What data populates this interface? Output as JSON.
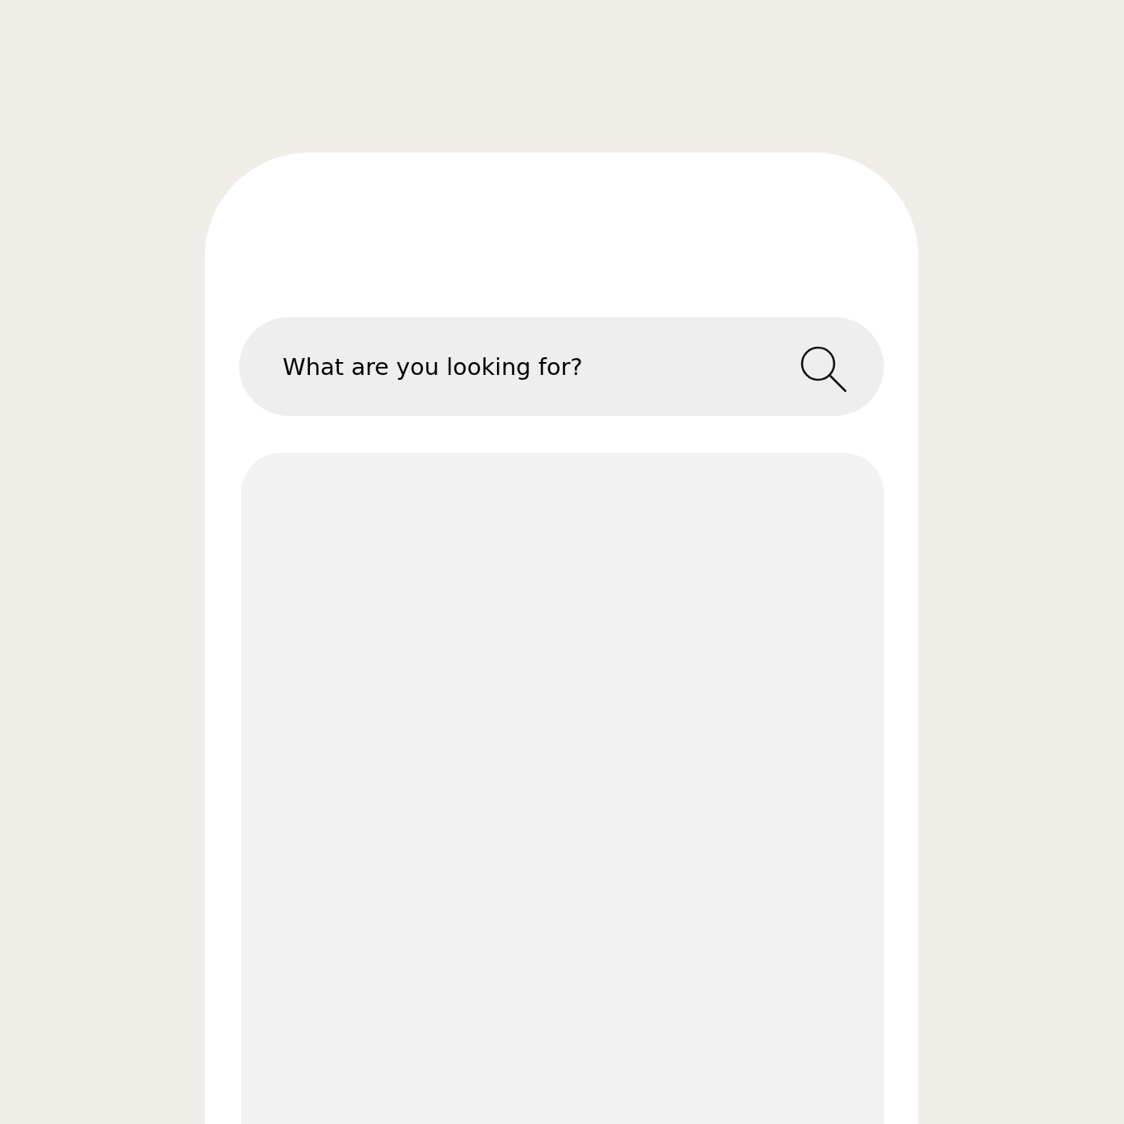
{
  "search": {
    "placeholder": "What are you looking for?"
  }
}
